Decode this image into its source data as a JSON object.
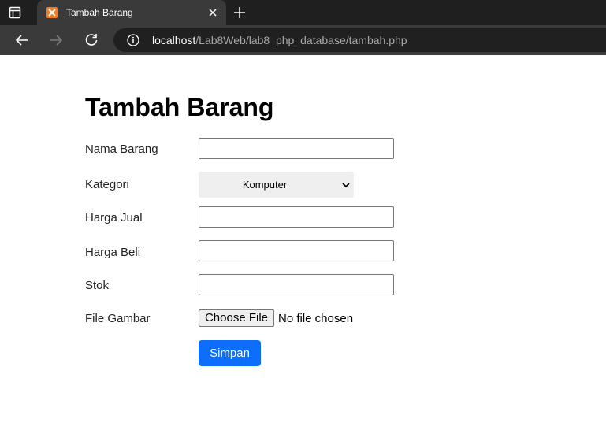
{
  "browser": {
    "tab_title": "Tambah Barang",
    "url_host": "localhost",
    "url_path": "/Lab8Web/lab8_php_database/tambah.php"
  },
  "page": {
    "title": "Tambah Barang",
    "fields": {
      "nama_label": "Nama Barang",
      "nama_value": "",
      "kategori_label": "Kategori",
      "kategori_value": "Komputer",
      "harga_jual_label": "Harga Jual",
      "harga_jual_value": "",
      "harga_beli_label": "Harga Beli",
      "harga_beli_value": "",
      "stok_label": "Stok",
      "stok_value": "",
      "gambar_label": "File Gambar",
      "choose_file_label": "Choose File",
      "file_status": "No file chosen"
    },
    "submit_label": "Simpan"
  },
  "colors": {
    "chrome_dark": "#1f1f1f",
    "chrome_toolbar": "#3a3a3a",
    "primary_button": "#0d6efd",
    "favicon": "#f37c20"
  }
}
